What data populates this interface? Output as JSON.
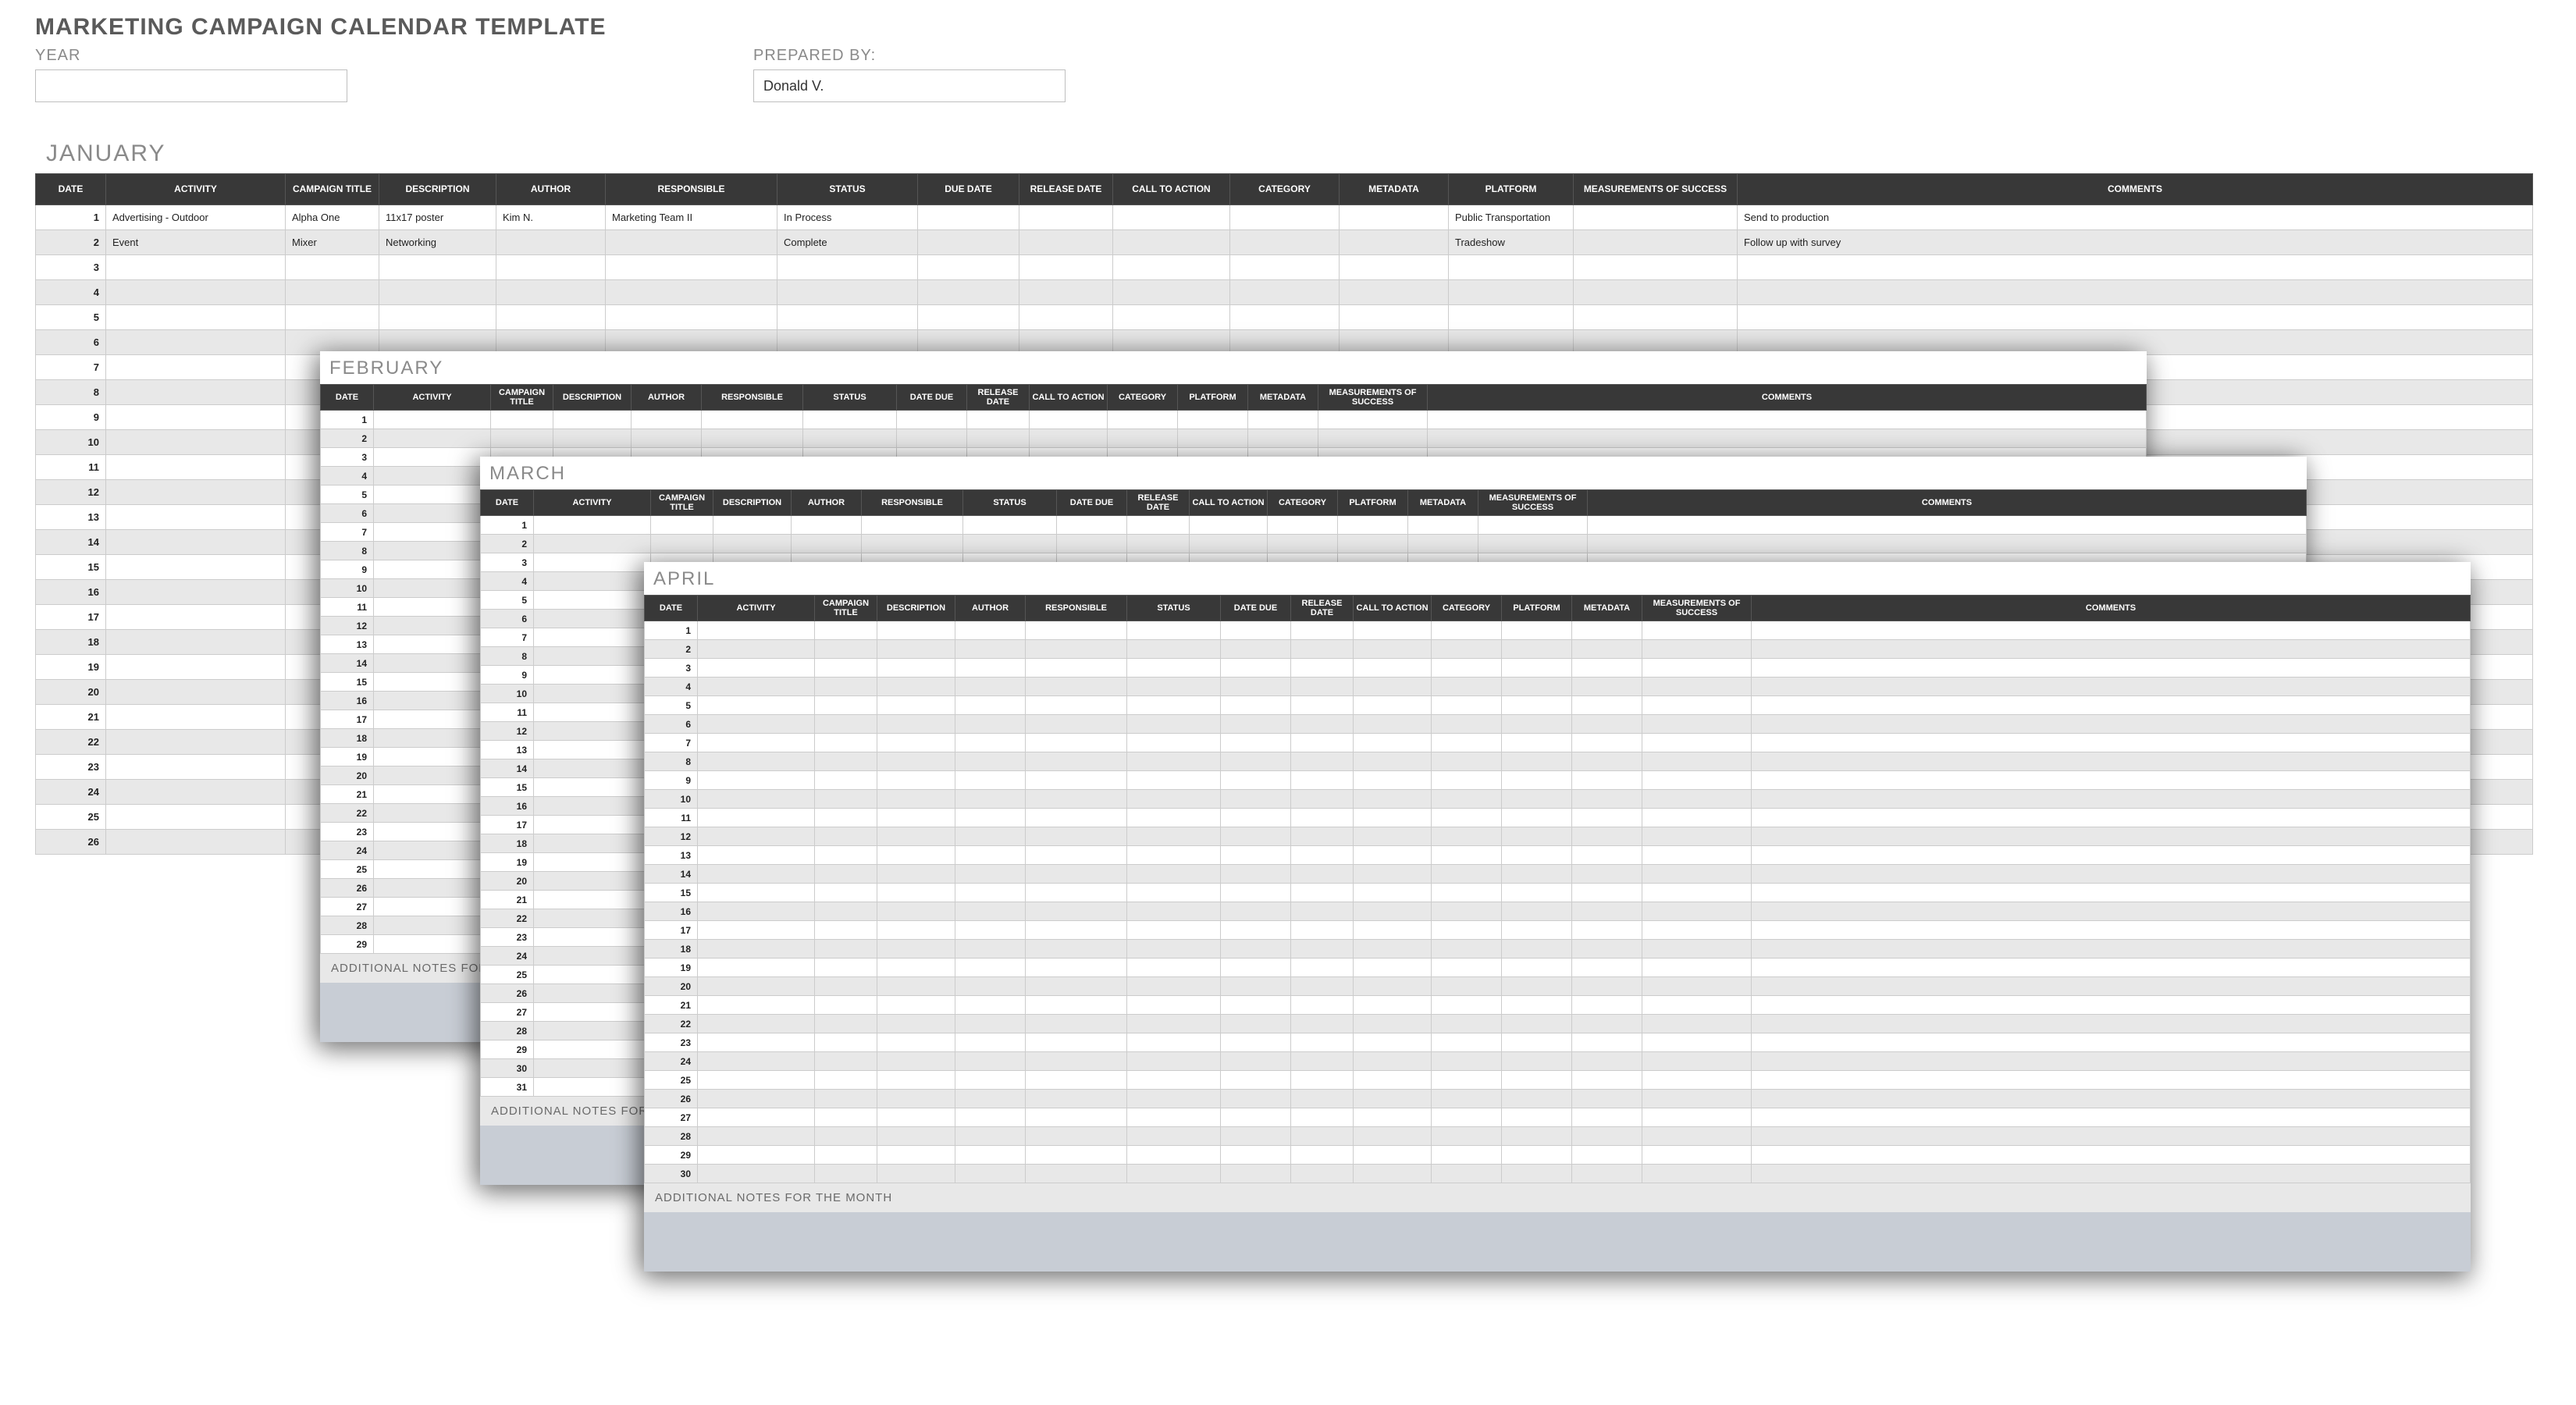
{
  "title": "MARKETING CAMPAIGN CALENDAR TEMPLATE",
  "meta": {
    "year_label": "YEAR",
    "year_value": "",
    "prepared_label": "PREPARED BY:",
    "prepared_value": "Donald V."
  },
  "headers": {
    "date": "DATE",
    "activity": "ACTIVITY",
    "campaign_title": "CAMPAIGN TITLE",
    "description": "DESCRIPTION",
    "author": "AUTHOR",
    "responsible": "RESPONSIBLE",
    "status": "STATUS",
    "due_date": "DUE DATE",
    "date_due": "DATE DUE",
    "release_date": "RELEASE DATE",
    "call_to_action": "CALL TO ACTION",
    "category": "CATEGORY",
    "metadata": "METADATA",
    "platform": "PLATFORM",
    "measurements": "MEASUREMENTS OF SUCCESS",
    "comments": "COMMENTS"
  },
  "notes_label": "ADDITIONAL NOTES FOR THE MONTH",
  "notes_label_partial": "ADDITIONAL NOTES FOR",
  "months": {
    "january": {
      "name": "JANUARY",
      "row_count": 26,
      "rows": [
        {
          "date": "1",
          "activity": "Advertising - Outdoor",
          "campaign_title": "Alpha One",
          "description": "11x17 poster",
          "author": "Kim N.",
          "responsible": "Marketing Team II",
          "status": "In Process",
          "due_date": "",
          "release_date": "",
          "call_to_action": "",
          "category": "",
          "metadata": "",
          "platform": "Public Transportation",
          "measurements": "",
          "comments": "Send to production"
        },
        {
          "date": "2",
          "activity": "Event",
          "campaign_title": "Mixer",
          "description": "Networking",
          "author": "",
          "responsible": "",
          "status": "Complete",
          "due_date": "",
          "release_date": "",
          "call_to_action": "",
          "category": "",
          "metadata": "",
          "platform": "Tradeshow",
          "measurements": "",
          "comments": "Follow up with survey"
        }
      ]
    },
    "february": {
      "name": "FEBRUARY",
      "row_count": 29
    },
    "march": {
      "name": "MARCH",
      "row_count": 31
    },
    "april": {
      "name": "APRIL",
      "row_count": 30
    }
  }
}
